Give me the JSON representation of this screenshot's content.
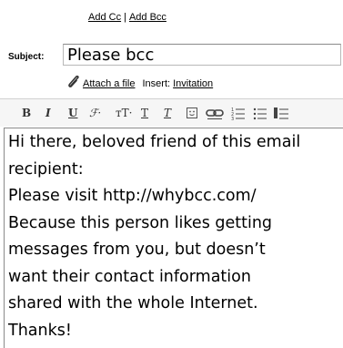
{
  "recipients": {
    "add_cc": "Add Cc",
    "separator": "|",
    "add_bcc": "Add Bcc"
  },
  "subject": {
    "label": "Subject:",
    "value": "Please bcc"
  },
  "attachments": {
    "attach_label": "Attach a file",
    "insert_label": "Insert:",
    "invitation_label": "Invitation"
  },
  "toolbar": {
    "bold": "B",
    "italic": "I",
    "underline": "U",
    "font": "ℱ·",
    "font_size": "тT·",
    "text_color": "T",
    "highlight": "T"
  },
  "message": {
    "lines": [
      "Hi there, beloved friend of this email",
      "recipient:",
      "Please visit http://whybcc.com/",
      "Because this person likes getting",
      "messages from you, but doesn’t",
      "want their contact information",
      "shared with the whole Internet.",
      "Thanks!"
    ]
  }
}
